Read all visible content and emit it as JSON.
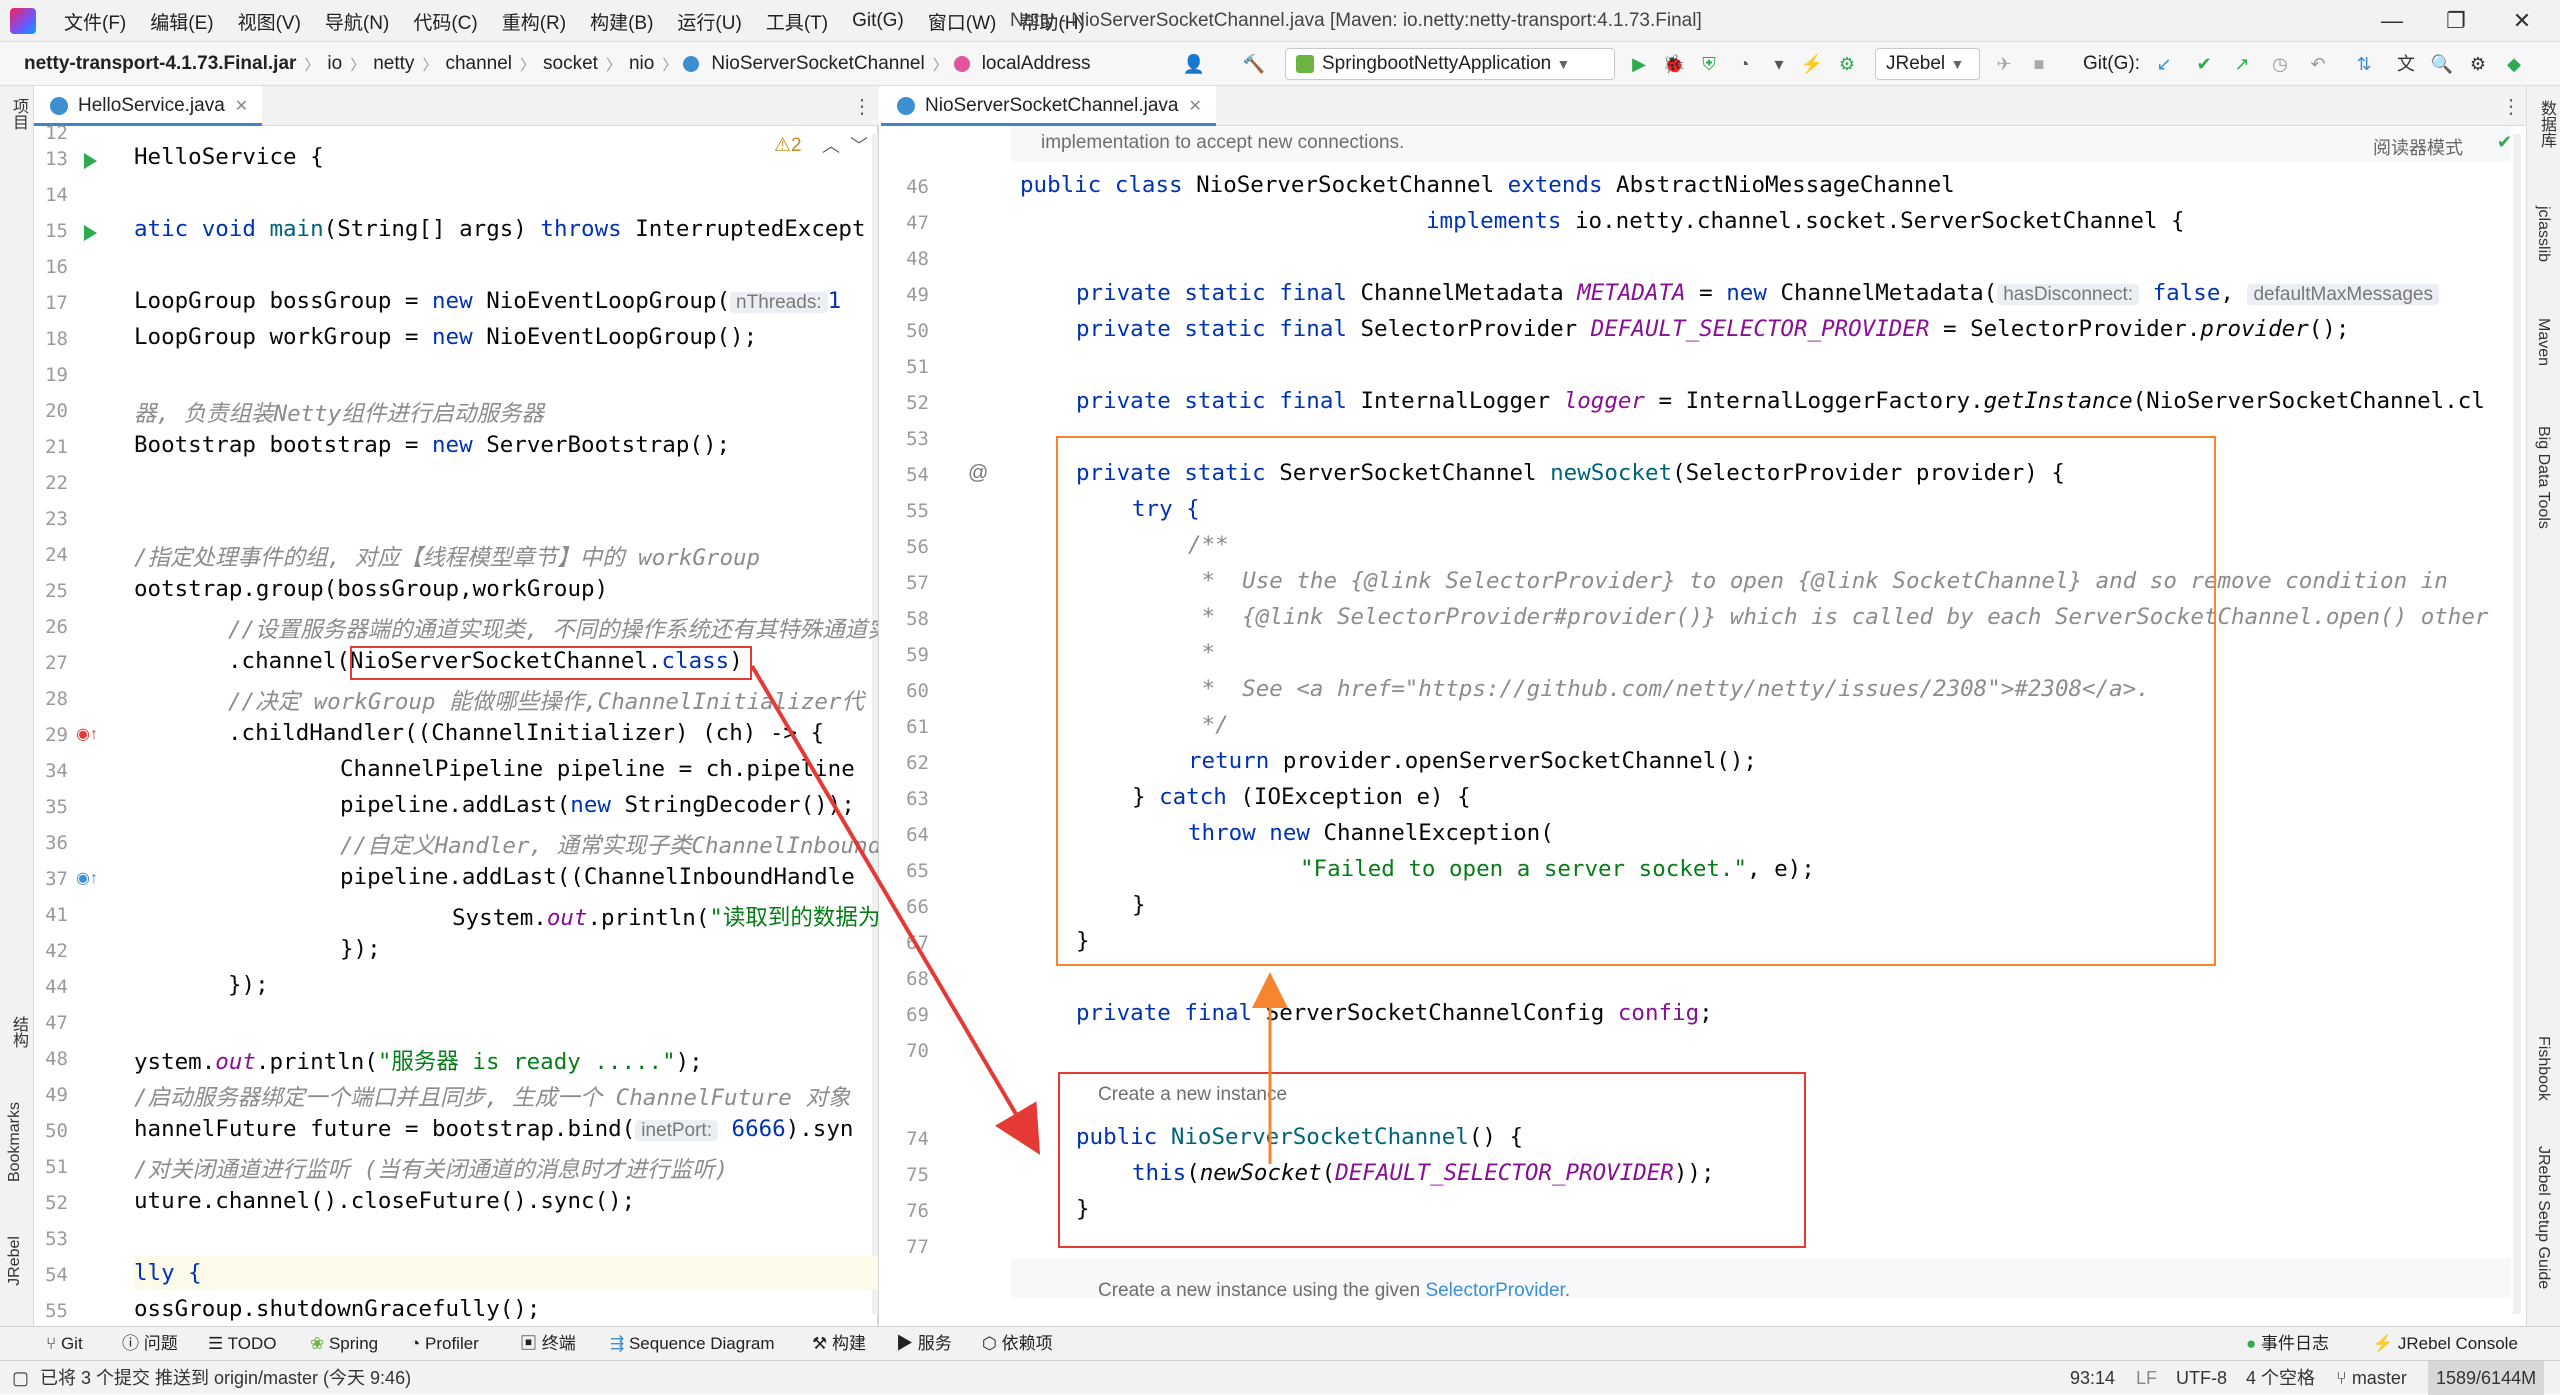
{
  "menubar": {
    "items": [
      "文件(F)",
      "编辑(E)",
      "视图(V)",
      "导航(N)",
      "代码(C)",
      "重构(R)",
      "构建(B)",
      "运行(U)",
      "工具(T)",
      "Git(G)",
      "窗口(W)",
      "帮助(H)"
    ],
    "window_title": "Netty - NioServerSocketChannel.java [Maven: io.netty:netty-transport:4.1.73.Final]",
    "minimize": "—",
    "maximize": "❐",
    "close": "✕"
  },
  "navbar": {
    "crumbs": [
      "netty-transport-4.1.73.Final.jar",
      "io",
      "netty",
      "channel",
      "socket",
      "nio",
      "NioServerSocketChannel",
      "localAddress"
    ],
    "run_config": "SpringbootNettyApplication",
    "jrebel": "JRebel",
    "git_label": "Git(G):"
  },
  "left_editor": {
    "tab": "HelloService.java",
    "warnings": "⚠2",
    "line_numbers": [
      "12",
      "13",
      "14",
      "15",
      "16",
      "17",
      "18",
      "19",
      "20",
      "21",
      "22",
      "23",
      "24",
      "25",
      "26",
      "27",
      "28",
      "29",
      "34",
      "35",
      "36",
      "37",
      "41",
      "42",
      "44",
      "47",
      "48",
      "49",
      "50",
      "51",
      "52",
      "53",
      "54",
      "55"
    ],
    "lines": {
      "l13a": "HelloService {",
      "l15a": "atic void ",
      "l15b": "main",
      "l15c": "(String[] args) ",
      "l15d": "throws",
      "l15e": " InterruptedExcept",
      "l17a": "LoopGroup bossGroup = ",
      "l17b": "new",
      "l17c": " NioEventLoopGroup(",
      "l17d": "nThreads:",
      "l17e": "1",
      "l18a": "LoopGroup workGroup = ",
      "l18b": "new",
      "l18c": " NioEventLoopGroup();",
      "l20": "器, 负责组装Netty组件进行启动服务器",
      "l21a": "Bootstrap bootstrap = ",
      "l21b": "new",
      "l21c": " ServerBootstrap();",
      "l24": "/指定处理事件的组, 对应【线程模型章节】中的 workGroup",
      "l25": "ootstrap.group(bossGroup,workGroup)",
      "l26": "//设置服务器端的通道实现类, 不同的操作系统还有其特殊通道实",
      "l27a": ".channel(",
      "l27b": "NioServerSocketChannel.",
      "l27c": "class",
      "l27d": ")",
      "l28": "//决定 workGroup 能做哪些操作,ChannelInitializer代",
      "l29a": ".childHandler((ChannelInitializer) (ch) -> {",
      "l34a": "ChannelPipeline pipeline = ch.pipeline",
      "l35a": "pipeline.addLast(",
      "l35b": "new",
      "l35c": " StringDecoder());",
      "l36": "//自定义Handler, 通常实现子类ChannelInbound",
      "l37a": "pipeline.addLast((ChannelInboundHandle",
      "l41a": "System.",
      "l41b": "out",
      "l41c": ".println(",
      "l41d": "\"读取到的数据为",
      "l42": "});",
      "l44": "});",
      "l48a": "ystem.",
      "l48b": "out",
      "l48c": ".println(",
      "l48d": "\"服务器 is ready .....\"",
      "l48e": ");",
      "l49": "/启动服务器绑定一个端口并且同步, 生成一个 ChannelFuture 对象",
      "l50a": "hannelFuture future = bootstrap.bind(",
      "l50b": "inetPort:",
      "l50c": "6666",
      "l50d": ").syn",
      "l51": "/对关闭通道进行监听 (当有关闭通道的消息时才进行监听)",
      "l52": "uture.channel().closeFuture().sync();",
      "l54": "lly {",
      "l55": "ossGroup.shutdownGracefully();"
    }
  },
  "right_editor": {
    "tab": "NioServerSocketChannel.java",
    "reader_mode": "阅读器模式",
    "doc_top": "implementation to accept new connections.",
    "line_numbers": [
      "46",
      "47",
      "48",
      "49",
      "50",
      "51",
      "52",
      "53",
      "54",
      "55",
      "56",
      "57",
      "58",
      "59",
      "60",
      "61",
      "62",
      "63",
      "64",
      "65",
      "66",
      "67",
      "68",
      "69",
      "70",
      "74",
      "75",
      "76",
      "77"
    ],
    "lines": {
      "l46a": "public class ",
      "l46b": "NioServerSocketChannel ",
      "l46c": "extends ",
      "l46d": "AbstractNioMessageChannel",
      "l47a": "implements ",
      "l47b": "io.netty.channel.socket.ServerSocketChannel {",
      "l49a": "private static final ",
      "l49b": "ChannelMetadata ",
      "l49c": "METADATA",
      "l49d": " = ",
      "l49e": "new ",
      "l49f": "ChannelMetadata(",
      "l49g": "hasDisconnect:",
      "l49h": "false",
      "l49i": ",",
      "l49j": "defaultMaxMessages",
      "l50a": "private static final ",
      "l50b": "SelectorProvider ",
      "l50c": "DEFAULT_SELECTOR_PROVIDER",
      "l50d": " = SelectorProvider.",
      "l50e": "provider",
      "l50f": "();",
      "l52a": "private static final ",
      "l52b": "InternalLogger ",
      "l52c": "logger",
      "l52d": " = InternalLoggerFactory.",
      "l52e": "getInstance",
      "l52f": "(NioServerSocketChannel.cl",
      "l54a": "private static ",
      "l54b": "ServerSocketChannel ",
      "l54c": "newSocket",
      "l54d": "(SelectorProvider provider) {",
      "l55": "try {",
      "l56": "/**",
      "l57": " *  Use the {@link SelectorProvider} to open {@link SocketChannel} and so remove condition in",
      "l58": " *  {@link SelectorProvider#provider()} which is called by each ServerSocketChannel.open() other",
      "l59": " *",
      "l60": " *  See <a href=\"https://github.com/netty/netty/issues/2308\">#2308</a>.",
      "l61": " */",
      "l62a": "return ",
      "l62b": "provider.openServerSocketChannel();",
      "l63a": "} ",
      "l63b": "catch ",
      "l63c": "(IOException e) {",
      "l64a": "throw new ",
      "l64b": "ChannelException(",
      "l65a": "\"Failed to open a server socket.\"",
      "l65b": ", e);",
      "l66": "}",
      "l67": "}",
      "l69a": "private final ",
      "l69b": "ServerSocketChannelConfig ",
      "l69c": "config",
      "l69d": ";",
      "doc73": "Create a new instance",
      "l74a": "public ",
      "l74b": "NioServerSocketChannel",
      "l74c": "() {",
      "l75a": "this",
      "l75b": "(",
      "l75c": "newSocket",
      "l75d": "(",
      "l75e": "DEFAULT_SELECTOR_PROVIDER",
      "l75f": "));",
      "l76": "}",
      "doc78a": "Create a new instance using the given ",
      "doc78b": "SelectorProvider",
      "doc78c": "."
    }
  },
  "side_labels": {
    "left": [
      "项目",
      "结构",
      "Bookmarks",
      "JRebel"
    ],
    "right": [
      "数据库",
      "jclasslib",
      "Maven",
      "Big Data Tools",
      "Fishbook",
      "JRebel Setup Guide"
    ]
  },
  "bottom_toolbar": {
    "items": [
      "Git",
      "问题",
      "TODO",
      "Spring",
      "Profiler",
      "终端",
      "Sequence Diagram",
      "构建",
      "服务",
      "依赖项"
    ],
    "right_items": [
      "事件日志",
      "JRebel Console"
    ]
  },
  "statusbar": {
    "message": "已将 3 个提交 推送到 origin/master (今天 9:46)",
    "position": "93:14",
    "line_sep": "LF",
    "encoding": "UTF-8",
    "indent": "4 个空格",
    "branch": "master",
    "memory": "1589/6144M"
  },
  "colors": {
    "accent": "#4083c9",
    "highlight_orange": "#f5862f",
    "highlight_red": "#e53935",
    "keyword": "#0033b3",
    "string": "#067d17"
  }
}
